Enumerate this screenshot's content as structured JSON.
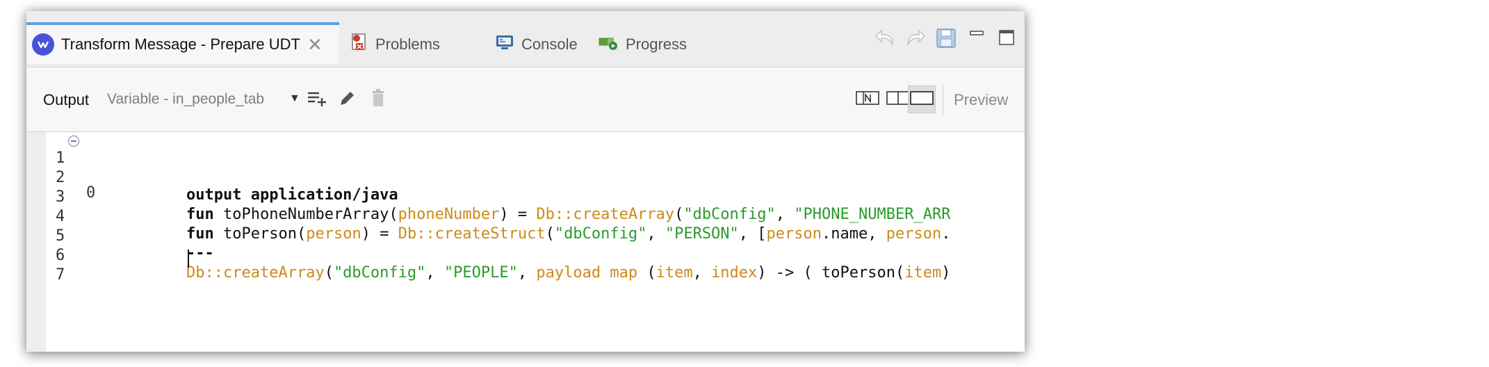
{
  "tabs": [
    {
      "label": "Transform Message - Prepare UDT",
      "icon": "mule-icon",
      "active": true
    },
    {
      "label": "Problems",
      "icon": "problems-icon"
    },
    {
      "label": "Console",
      "icon": "console-icon"
    },
    {
      "label": "Progress",
      "icon": "progress-icon"
    }
  ],
  "toolbar": {
    "output_label": "Output",
    "variable_label": "Variable - in_people_tab",
    "preview_label": "Preview"
  },
  "editor": {
    "lines": [
      {
        "num": "1",
        "text": "0"
      },
      {
        "num": "2",
        "text": "output application/java"
      },
      {
        "num": "3",
        "text": "fun toPhoneNumberArray(phoneNumber) = Db::createArray(\"dbConfig\", \"PHONE_NUMBER_ARR"
      },
      {
        "num": "4",
        "text": "fun toPerson(person) = Db::createStruct(\"dbConfig\", \"PERSON\", [person.name, person."
      },
      {
        "num": "5",
        "text": "---"
      },
      {
        "num": "6",
        "text": "Db::createArray(\"dbConfig\", \"PEOPLE\", payload map (item, index) -> ( toPerson(item)"
      },
      {
        "num": "7",
        "text": ""
      }
    ]
  },
  "colors": {
    "accent": "#5a9fe0",
    "keyword_orange": "#cc8a1a",
    "string_green": "#2a9a2a"
  }
}
